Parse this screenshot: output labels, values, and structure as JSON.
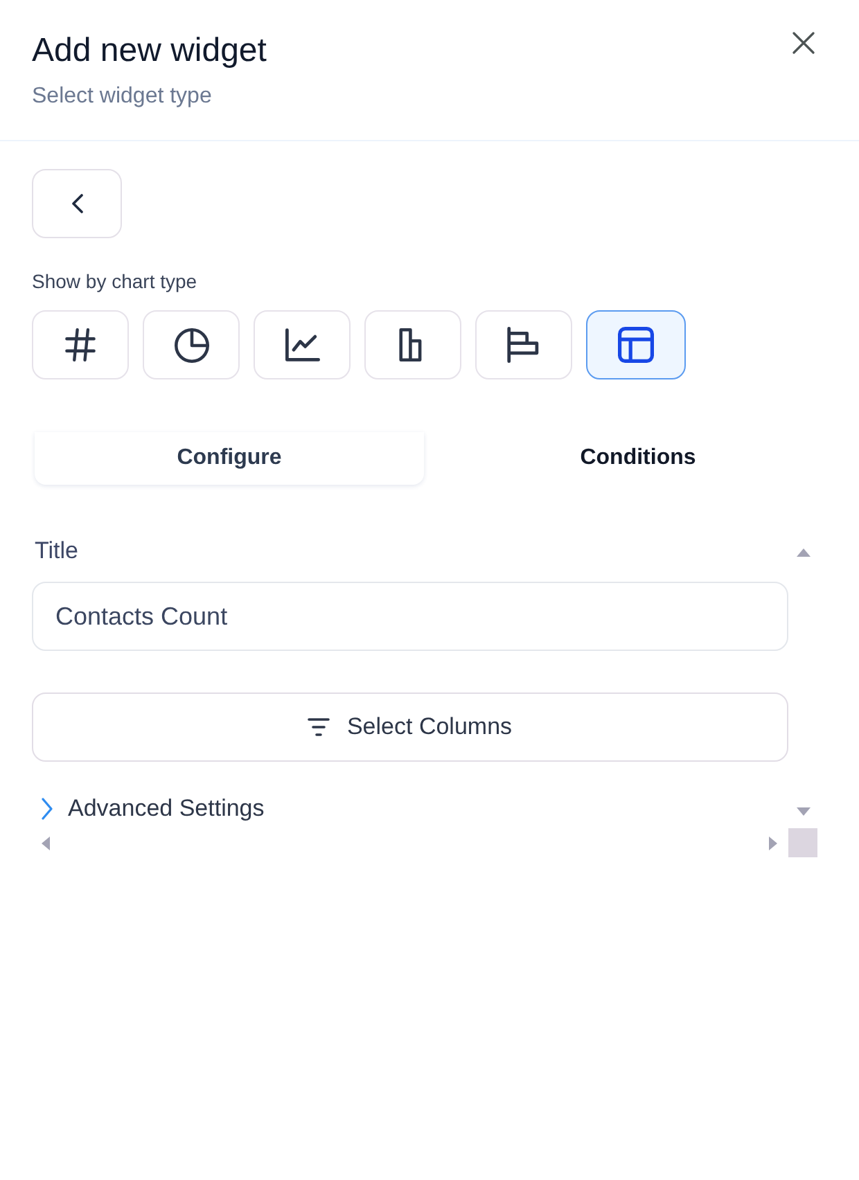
{
  "header": {
    "title": "Add new widget",
    "subtitle": "Select widget type"
  },
  "chart_type": {
    "label": "Show by chart type",
    "options": [
      {
        "kind": "number",
        "selected": false
      },
      {
        "kind": "pie",
        "selected": false
      },
      {
        "kind": "line",
        "selected": false
      },
      {
        "kind": "bar",
        "selected": false
      },
      {
        "kind": "horizontal_bar",
        "selected": false
      },
      {
        "kind": "table",
        "selected": true
      }
    ]
  },
  "tabs": [
    {
      "label": "Configure",
      "selected": true
    },
    {
      "label": "Conditions",
      "selected": false
    }
  ],
  "title_field": {
    "label": "Title",
    "value": "Contacts Count"
  },
  "select_columns_button": {
    "label": "Select Columns"
  },
  "advanced_settings": {
    "label": "Advanced Settings",
    "expanded": false
  }
}
